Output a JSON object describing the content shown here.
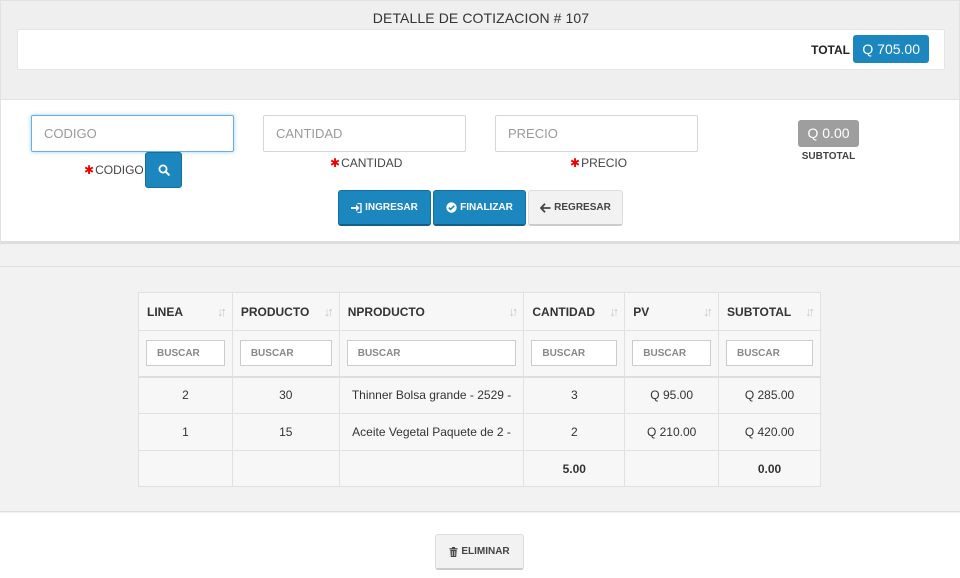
{
  "header": {
    "title": "DETALLE DE COTIZACION # 107",
    "total_label": "TOTAL",
    "total_value": "Q 705.00"
  },
  "form": {
    "codigo": {
      "placeholder": "CODIGO",
      "label": "CODIGO"
    },
    "cantidad": {
      "placeholder": "CANTIDAD",
      "label": "CANTIDAD"
    },
    "precio": {
      "placeholder": "PRECIO",
      "label": "PRECIO"
    },
    "subtotal_value": "Q 0.00",
    "subtotal_label": "SUBTOTAL",
    "buttons": {
      "ingresar": "INGRESAR",
      "finalizar": "FINALIZAR",
      "regresar": "REGRESAR"
    }
  },
  "table": {
    "columns": [
      "LINEA",
      "PRODUCTO",
      "NPRODUCTO",
      "CANTIDAD",
      "PV",
      "SUBTOTAL"
    ],
    "filter_placeholder": "BUSCAR",
    "rows": [
      [
        "2",
        "30",
        "Thinner Bolsa grande - 2529 -",
        "3",
        "Q 95.00",
        "Q 285.00"
      ],
      [
        "1",
        "15",
        "Aceite Vegetal Paquete de 2 -",
        "2",
        "Q 210.00",
        "Q 420.00"
      ]
    ],
    "totals": {
      "cantidad": "5.00",
      "subtotal": "0.00"
    }
  },
  "actions": {
    "eliminar": "ELIMINAR"
  },
  "colors": {
    "primary": "#1c86bf",
    "required": "#ee0000",
    "subtotal_badge": "#9e9e9e"
  }
}
